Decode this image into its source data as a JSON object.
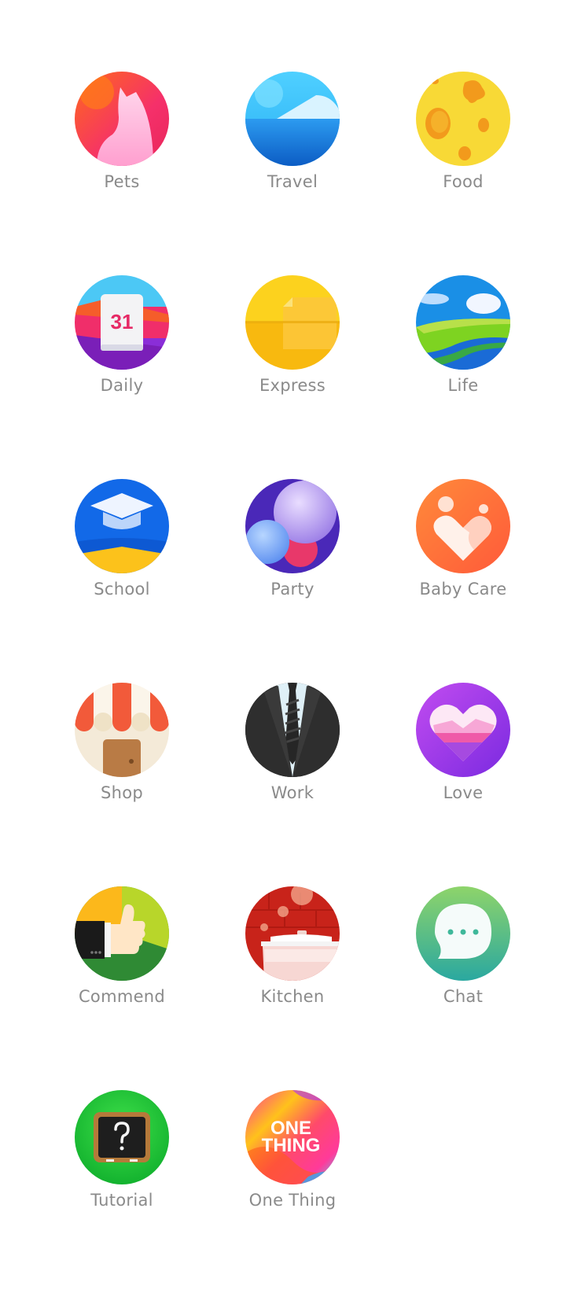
{
  "categories": [
    {
      "label": "Pets",
      "icon": "cat-icon",
      "color": "#f0355f"
    },
    {
      "label": "Travel",
      "icon": "ocean-icon",
      "color": "#1d8fe8"
    },
    {
      "label": "Food",
      "icon": "cheese-icon",
      "color": "#f7cf2c"
    },
    {
      "label": "Daily",
      "icon": "calendar-icon",
      "color": "#e62a66",
      "icon_text": "31"
    },
    {
      "label": "Express",
      "icon": "package-icon",
      "color": "#fcc21b"
    },
    {
      "label": "Life",
      "icon": "landscape-icon",
      "color": "#1a8fe6"
    },
    {
      "label": "School",
      "icon": "graduation-cap-icon",
      "color": "#1266e8"
    },
    {
      "label": "Party",
      "icon": "balloons-icon",
      "color": "#6a3fd6"
    },
    {
      "label": "Baby Care",
      "icon": "heart-hand-icon",
      "color": "#ff6a3a"
    },
    {
      "label": "Shop",
      "icon": "storefront-icon",
      "color": "#f25a3a"
    },
    {
      "label": "Work",
      "icon": "suit-tie-icon",
      "color": "#1f1f1f"
    },
    {
      "label": "Love",
      "icon": "heart-icon",
      "color": "#a53be8"
    },
    {
      "label": "Commend",
      "icon": "thumbs-up-icon",
      "color": "#5aa43a"
    },
    {
      "label": "Kitchen",
      "icon": "pot-icon",
      "color": "#c8231a"
    },
    {
      "label": "Chat",
      "icon": "chat-bubble-icon",
      "color": "#3fb89a"
    },
    {
      "label": "Tutorial",
      "icon": "blackboard-question-icon",
      "color": "#1ec83a"
    },
    {
      "label": "One Thing",
      "icon": "one-thing-logo-icon",
      "color": "#ff3a7a",
      "icon_text_line1": "ONE",
      "icon_text_line2": "THING"
    }
  ]
}
